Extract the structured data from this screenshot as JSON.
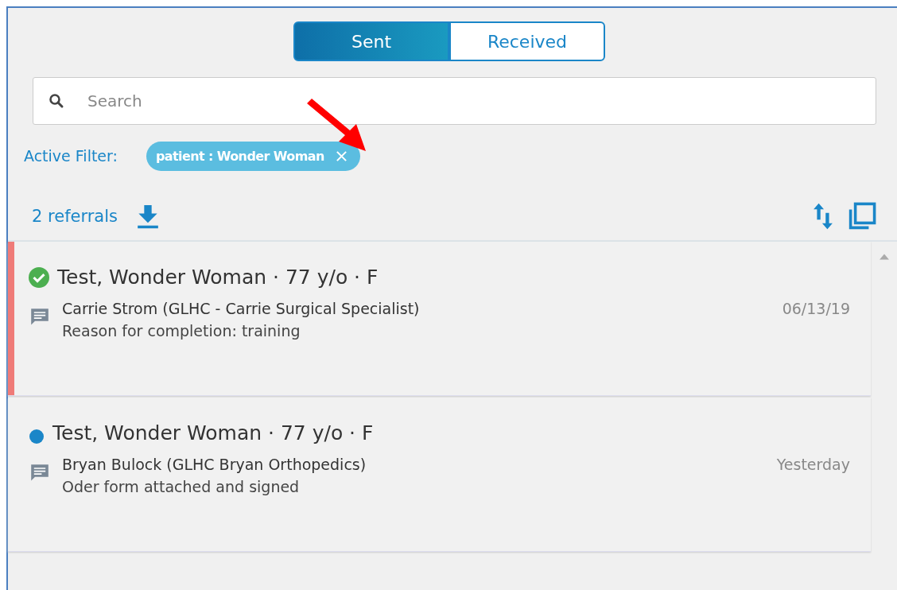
{
  "tabs": [
    {
      "label": "Sent",
      "selected": true
    },
    {
      "label": "Received",
      "selected": false
    }
  ],
  "search": {
    "placeholder": "Search"
  },
  "active_filter": {
    "label": "Active Filter:",
    "chip": "patient : Wonder Woman"
  },
  "results": {
    "count": "2 referrals"
  },
  "referrals": [
    {
      "kind": "completed",
      "selected": true,
      "title": "Test, Wonder Woman · 77 y/o · F",
      "sender": "Carrie Strom (GLHC - Carrie Surgical Specialist)",
      "note": "Reason for completion: training",
      "date": "06/13/19"
    },
    {
      "kind": "new",
      "selected": false,
      "title": "Test, Wonder Woman · 77 y/o · F",
      "sender": "Bryan Bulock (GLHC Bryan Orthopedics)",
      "note": "Oder form attached and signed",
      "date": "Yesterday"
    }
  ]
}
